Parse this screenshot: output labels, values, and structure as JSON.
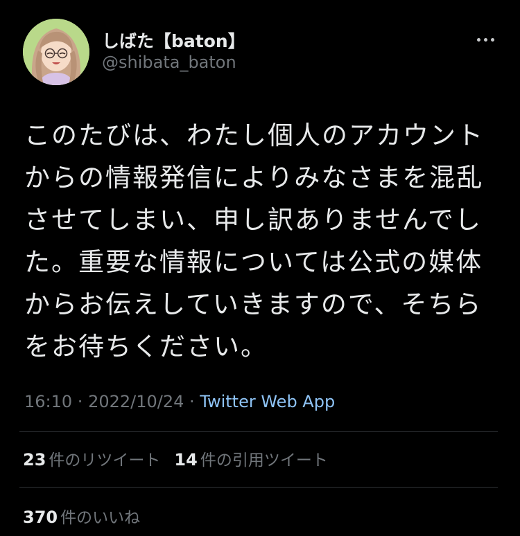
{
  "user": {
    "display_name": "しばた【baton】",
    "handle": "@shibata_baton",
    "avatar_icon": "user-avatar-icon"
  },
  "more_icon": "more-horizontal-icon",
  "tweet": {
    "lines": [
      "このたびは、わたし個人のアカウント",
      "からの情報発信によりみなさまを混乱",
      "させてしまい、申し訳ありませんでし",
      "た。重要な情報については公式の媒体",
      "からお伝えしていきますので、そちら",
      "をお待ちください。"
    ]
  },
  "meta": {
    "time": "16:10",
    "separator1": " · ",
    "date": "2022/10/24",
    "separator2": " · ",
    "source": "Twitter Web App"
  },
  "stats": {
    "retweets": {
      "count": "23",
      "label": "件のリツイート"
    },
    "quotes": {
      "count": "14",
      "label": "件の引用ツイート"
    },
    "likes": {
      "count": "370",
      "label": "件のいいね"
    }
  },
  "colors": {
    "background": "#000000",
    "text": "#e7e9ea",
    "secondary": "#71767b",
    "link": "#8ec3f5",
    "divider": "#2f3336"
  }
}
